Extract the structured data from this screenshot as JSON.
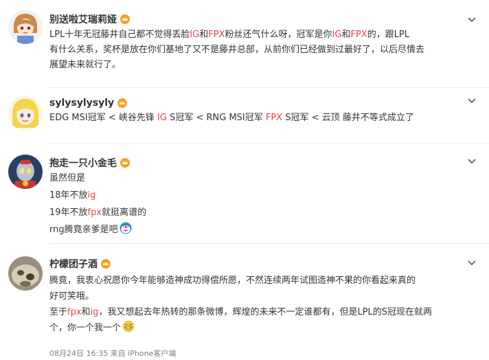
{
  "comments": [
    {
      "username": "别送啦艾瑞莉娅",
      "lines": [
        [
          {
            "t": "LPL十年无冠藤井自己都不觉得丢脸"
          },
          {
            "t": "IG",
            "hl": true
          },
          {
            "t": "和"
          },
          {
            "t": "FPX",
            "hl": true
          },
          {
            "t": "粉丝还气什么呀，冠军是你"
          },
          {
            "t": "IG",
            "hl": true
          },
          {
            "t": "和"
          },
          {
            "t": "FPX",
            "hl": true
          },
          {
            "t": "的，跟LPL"
          }
        ],
        [
          {
            "t": "有什么关系，奖杯是放在你们基地了又不是藤井总部，从前你们已经做到过最好了，以后尽情去"
          }
        ],
        [
          {
            "t": "展望未来就行了。"
          }
        ]
      ]
    },
    {
      "username": "sylysylysyly",
      "lines": [
        [
          {
            "t": "EDG MSI冠军 < 峡谷先锋 "
          },
          {
            "t": "IG",
            "hl": true
          },
          {
            "t": " S冠军 < RNG MSI冠军 "
          },
          {
            "t": "FPX",
            "hl": true
          },
          {
            "t": " S冠军 < 云顶 藤井不等式成立了"
          }
        ]
      ]
    },
    {
      "username": "抱走一只小金毛",
      "lines": [
        [
          {
            "t": "虽然但是"
          }
        ],
        [
          {
            "t": "18年不放"
          },
          {
            "t": "ig",
            "hl": true
          }
        ],
        [
          {
            "t": "19年不放"
          },
          {
            "t": "fpx",
            "hl": true
          },
          {
            "t": "就挺离谱的"
          }
        ],
        [
          {
            "t": "rng腾竟亲爹是吧"
          }
        ]
      ]
    },
    {
      "username": "柠檬团子酒",
      "lines": [
        [
          {
            "t": "腾竟，我衷心祝愿你今年能够造神成功得偿所愿，不然连续两年试图造神不果的你看起来真的"
          }
        ],
        [
          {
            "t": "好可笑哦。"
          }
        ],
        [
          {
            "t": "至于"
          },
          {
            "t": "fpx",
            "hl": true
          },
          {
            "t": "和"
          },
          {
            "t": "ig",
            "hl": true
          },
          {
            "t": "，我又想起去年热转的那条微博，辉煌的未来不一定谁都有，但是LPL的S冠现在就两"
          }
        ],
        [
          {
            "t": "个，你一个我一个"
          }
        ]
      ],
      "meta": "08月24日 16:35  来自 iPhone客户端"
    }
  ]
}
